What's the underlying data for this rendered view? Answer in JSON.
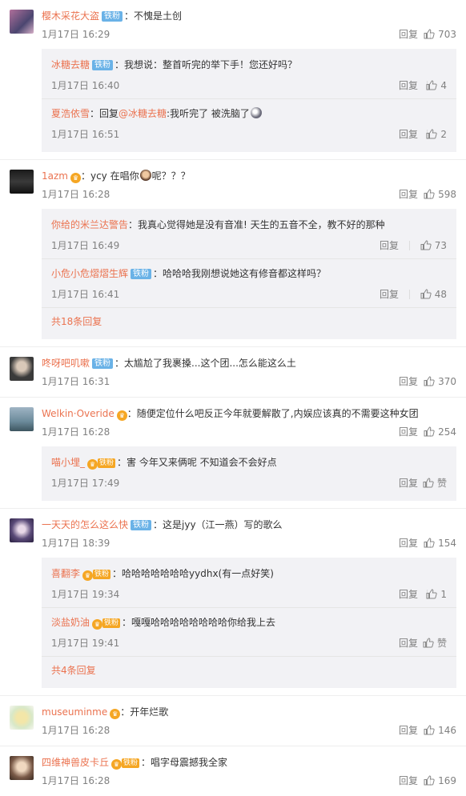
{
  "comments": [
    {
      "user": "樱木采花大盗",
      "badge": "铁粉",
      "text": "：不愧是土创",
      "time": "1月17日 16:29",
      "reply": "回复",
      "likes": "703",
      "subs": [
        {
          "user": "冰糖去糖",
          "badge": "铁粉",
          "text": "：我想说：整首听完的举下手！您还好吗？",
          "time": "1月17日 16:40",
          "reply": "回复",
          "likes": "4"
        },
        {
          "user": "夏浩依雪",
          "text_pre": "：回复",
          "at": "@冰糖去糖",
          "text": ":我听完了 被洗脑了",
          "time": "1月17日 16:51",
          "reply": "回复",
          "likes": "2"
        }
      ]
    },
    {
      "user": "1azm",
      "text_pre": "：ycy 在唱你",
      "text": "呢？？？",
      "time": "1月17日 16:28",
      "reply": "回复",
      "likes": "598",
      "subs": [
        {
          "user": "你给的米兰达警告",
          "text": "：我真心觉得她是没有音准! 天生的五音不全，教不好的那种",
          "time": "1月17日 16:49",
          "reply": "回复",
          "likes": "73"
        },
        {
          "user": "小危小危熠熠生辉",
          "badge": "铁粉",
          "text": "：哈哈哈我刚想说她这有修音都这样吗？",
          "time": "1月17日 16:41",
          "reply": "回复",
          "likes": "48"
        }
      ],
      "more": "共18条回复"
    },
    {
      "user": "咚呀吧叽嗽",
      "badge": "铁粉",
      "text": "：太尴尬了我裹搡...这个团...怎么能这么土",
      "time": "1月17日 16:31",
      "reply": "回复",
      "likes": "370"
    },
    {
      "user": "Welkin·Overide",
      "text": "：随便定位什么吧反正今年就要解散了,内娱应该真的不需要这种女团",
      "time": "1月17日 16:28",
      "reply": "回复",
      "likes": "254",
      "subs": [
        {
          "user": "喵小埋_",
          "badge": "铁粉",
          "text": "：害 今年又来俩呢 不知道会不会好点",
          "time": "1月17日 17:49",
          "reply": "回复",
          "likes": "赞"
        }
      ]
    },
    {
      "user": "一天天的怎么这么快",
      "badge": "铁粉",
      "text": "：这是jyy（江一燕）写的歌么",
      "time": "1月17日 18:39",
      "reply": "回复",
      "likes": "154",
      "subs": [
        {
          "user": "喜翻李",
          "badge": "铁粉",
          "text": "：哈哈哈哈哈哈哈yydhx(有一点好笑)",
          "time": "1月17日 19:34",
          "reply": "回复",
          "likes": "1"
        },
        {
          "user": "淡盐奶油",
          "badge": "铁粉",
          "text": "：嘎嘎哈哈哈哈哈哈哈哈你给我上去",
          "time": "1月17日 19:41",
          "reply": "回复",
          "likes": "赞"
        }
      ],
      "more": "共4条回复"
    },
    {
      "user": "museuminme",
      "text": "：开年烂歌",
      "time": "1月17日 16:28",
      "reply": "回复",
      "likes": "146"
    },
    {
      "user": "四维神兽皮卡丘",
      "badge": "铁粉",
      "text": "：唱字母震撼我全家",
      "time": "1月17日 16:28",
      "reply": "回复",
      "likes": "169"
    }
  ],
  "colors": {
    "accent": "#eb7350",
    "badge_blue": "#6ab2e7",
    "vip_gold": "#f5a623",
    "reply_bg": "#f2f2f5"
  }
}
